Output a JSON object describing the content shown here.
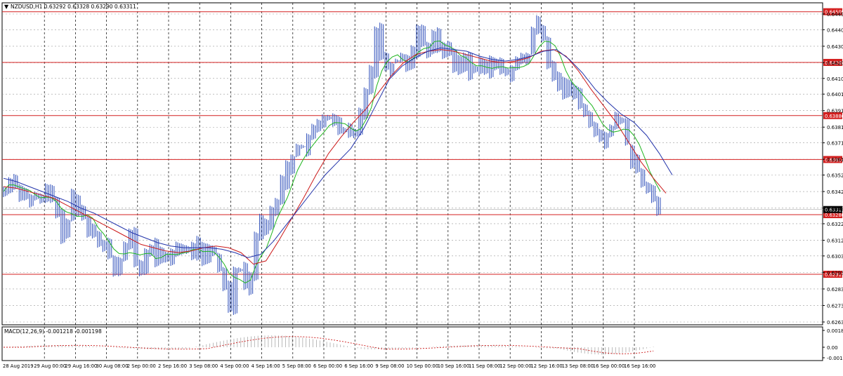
{
  "main": {
    "symbol_info": "NZDUSD,H1  0.63292 0.63328 0.63290 0.63311"
  },
  "macd": {
    "label": "MACD(12,26,9) -0.001218 -0.001198",
    "axis_ticks": [
      "0.00181",
      "0.00",
      "-0.00138"
    ]
  },
  "colors": {
    "background": "#ffffff",
    "grid": "#000000",
    "candles": "#3d5bbf",
    "ma_fast": "#1fb51f",
    "ma_mid": "#cc1a1a",
    "ma_slow": "#2233aa",
    "level_line": "#d42020",
    "level_badge": "#d42020",
    "current_badge": "#000000"
  },
  "chart_data": {
    "type": "line",
    "title": "NZDUSD,H1",
    "x_tick_labels": [
      "28 Aug 2019",
      "29 Aug 00:00",
      "29 Aug 16:00",
      "30 Aug 08:00",
      "2 Sep 00:00",
      "2 Sep 16:00",
      "3 Sep 08:00",
      "4 Sep 00:00",
      "4 Sep 16:00",
      "5 Sep 08:00",
      "6 Sep 00:00",
      "6 Sep 16:00",
      "9 Sep 08:00",
      "10 Sep 00:00",
      "10 Sep 16:00",
      "11 Sep 08:00",
      "12 Sep 00:00",
      "12 Sep 16:00",
      "13 Sep 08:00",
      "16 Sep 00:00",
      "16 Sep 16:00"
    ],
    "y_tick_labels": [
      "0.64495",
      "0.64400",
      "0.64300",
      "0.64200",
      "0.64105",
      "0.64010",
      "0.63910",
      "0.63810",
      "0.63715",
      "0.63615",
      "0.63520",
      "0.63420",
      "0.63320",
      "0.63225",
      "0.63125",
      "0.63030",
      "0.62930",
      "0.62830",
      "0.62730",
      "0.62630"
    ],
    "ylim": [
      0.6263,
      0.64495
    ],
    "horizontal_levels": [
      0.64509,
      0.64202,
      0.6388,
      0.63614,
      0.6328,
      0.62919
    ],
    "current_price": 0.63311,
    "series": [
      {
        "values": [
          0.6342,
          0.635,
          0.6346,
          0.6341,
          0.6339,
          0.6337,
          0.6338,
          0.6336,
          0.6343,
          0.6338,
          0.6326,
          0.6316,
          0.6325,
          0.6338,
          0.633,
          0.6326,
          0.632,
          0.6315,
          0.631,
          0.6312,
          0.6303,
          0.6296,
          0.6301,
          0.6309,
          0.6316,
          0.63,
          0.6292,
          0.6305,
          0.631,
          0.63,
          0.6303,
          0.6302,
          0.6305,
          0.6309,
          0.6305,
          0.6305,
          0.631,
          0.6306,
          0.6302,
          0.6306,
          0.6303,
          0.6295,
          0.6284,
          0.6273,
          0.6295,
          0.6296,
          0.6285,
          0.6293,
          0.6315,
          0.6325,
          0.632,
          0.6328,
          0.6338,
          0.6348,
          0.6357,
          0.6363,
          0.637,
          0.6368,
          0.6374,
          0.6378,
          0.6383,
          0.6387,
          0.6388,
          0.6383,
          0.6377,
          0.638,
          0.6375,
          0.6378,
          0.639,
          0.6405,
          0.6416,
          0.644,
          0.6425,
          0.6417,
          0.642,
          0.6422,
          0.6425,
          0.6418,
          0.6428,
          0.644,
          0.6432,
          0.6428,
          0.6436,
          0.643,
          0.6428,
          0.6426,
          0.6418,
          0.642,
          0.6423,
          0.6414,
          0.6416,
          0.6418,
          0.6415,
          0.642,
          0.6418,
          0.6417,
          0.6414,
          0.6416,
          0.642,
          0.6422,
          0.6425,
          0.644,
          0.6443,
          0.6435,
          0.642,
          0.6413,
          0.6408,
          0.64,
          0.6405,
          0.64,
          0.6395,
          0.6388,
          0.6382,
          0.6378,
          0.6372,
          0.6378,
          0.638,
          0.6385,
          0.6384,
          0.637,
          0.636,
          0.6353,
          0.6346,
          0.6342,
          0.6338,
          0.6331
        ]
      },
      {
        "values": [
          0.6345,
          0.6344,
          0.6342,
          0.634,
          0.6338,
          0.6334,
          0.633,
          0.6326,
          0.6322,
          0.6318,
          0.6314,
          0.631,
          0.6308,
          0.6306,
          0.6305,
          0.6306,
          0.6308,
          0.6309,
          0.6308,
          0.6305,
          0.6298,
          0.63,
          0.6312,
          0.6325,
          0.6338,
          0.6352,
          0.6365,
          0.6375,
          0.6384,
          0.6392,
          0.6402,
          0.6412,
          0.642,
          0.6425,
          0.6427,
          0.6428,
          0.6427,
          0.6425,
          0.6423,
          0.6421,
          0.642,
          0.6421,
          0.6423,
          0.6427,
          0.6428,
          0.6424,
          0.6415,
          0.6404,
          0.6394,
          0.6384,
          0.6372,
          0.636,
          0.635,
          0.6341
        ]
      },
      {
        "values": [
          0.635,
          0.6348,
          0.6345,
          0.6342,
          0.6339,
          0.6336,
          0.6332,
          0.6329,
          0.6325,
          0.6321,
          0.6317,
          0.6314,
          0.6311,
          0.6309,
          0.6308,
          0.6308,
          0.6308,
          0.6307,
          0.6305,
          0.6302,
          0.6304,
          0.6312,
          0.6322,
          0.6332,
          0.6342,
          0.6352,
          0.636,
          0.6368,
          0.638,
          0.6395,
          0.641,
          0.6418,
          0.6423,
          0.6427,
          0.6429,
          0.6428,
          0.6427,
          0.6424,
          0.6422,
          0.6421,
          0.6422,
          0.6424,
          0.6427,
          0.6428,
          0.6422,
          0.6414,
          0.6404,
          0.6396,
          0.6389,
          0.6384,
          0.6376,
          0.6365,
          0.6352
        ]
      }
    ]
  }
}
